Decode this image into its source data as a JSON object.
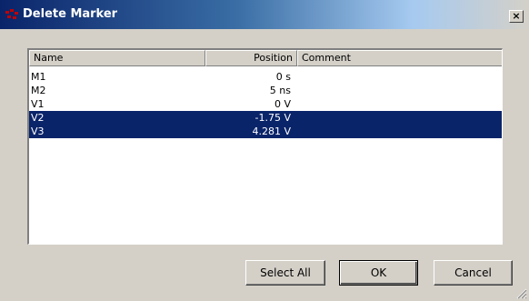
{
  "window": {
    "title": "Delete Marker",
    "close_glyph": "×",
    "icons": {
      "app": "app-icon",
      "close": "close-icon",
      "grip": "resize-grip-icon"
    }
  },
  "list": {
    "columns": [
      "Name",
      "Position",
      "Comment"
    ],
    "rows": [
      {
        "name": "M1",
        "position": "0 s",
        "comment": "",
        "selected": false
      },
      {
        "name": "M2",
        "position": "5 ns",
        "comment": "",
        "selected": false
      },
      {
        "name": "V1",
        "position": "0 V",
        "comment": "",
        "selected": false
      },
      {
        "name": "V2",
        "position": "-1.75 V",
        "comment": "",
        "selected": true
      },
      {
        "name": "V3",
        "position": "4.281 V",
        "comment": "",
        "selected": true
      }
    ]
  },
  "buttons": {
    "select_all": "Select All",
    "ok": "OK",
    "cancel": "Cancel"
  },
  "colors": {
    "selection": "#0a246a",
    "face": "#d4d0c8"
  }
}
